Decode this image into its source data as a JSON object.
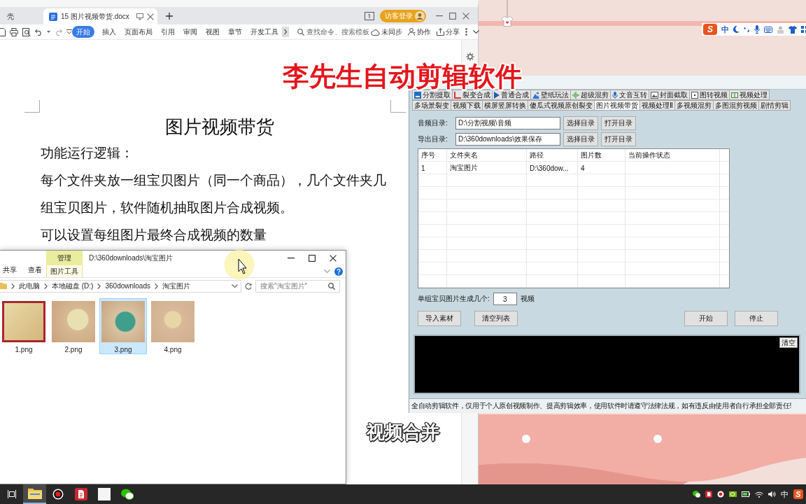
{
  "wps_window": {
    "tabs": [
      {
        "kind": "home",
        "label": "壳",
        "selected": false
      },
      {
        "kind": "document",
        "label": "15 图片视频带货.docx",
        "selected": true
      }
    ],
    "login_button": "访客登录",
    "ribbon_tabs": [
      {
        "label": "开始",
        "selected": true
      },
      {
        "label": "插入",
        "selected": false
      },
      {
        "label": "页面布局",
        "selected": false
      },
      {
        "label": "引用",
        "selected": false
      },
      {
        "label": "审阅",
        "selected": false
      },
      {
        "label": "视图",
        "selected": false
      },
      {
        "label": "章节",
        "selected": false
      },
      {
        "label": "开发工具",
        "selected": false
      }
    ],
    "search": {
      "placeholder": "查找命令、搜索模板"
    },
    "actions": [
      {
        "kind": "sync",
        "label": "未同步"
      },
      {
        "kind": "collaborate",
        "label": "协作"
      },
      {
        "kind": "share",
        "label": "分享"
      }
    ],
    "document": {
      "title": "图片视频带货",
      "paragraphs": [
        "功能运行逻辑：",
        "每个文件夹放一组宝贝图片（同一个商品），几个文件夹几",
        "组宝贝图片，软件随机抽取图片合成视频。",
        "可以设置每组图片最终合成视频的数量"
      ]
    }
  },
  "captions": [
    {
      "kind": "title",
      "text": "李先生自动剪辑软件"
    },
    {
      "kind": "subtitle",
      "text": "视频合并"
    }
  ],
  "ime_toolbar": {
    "logo": "S",
    "mode": "中"
  },
  "editor_window": {
    "tab_rows": [
      [
        {
          "kind": "split",
          "label": "分割提取",
          "selected": false
        },
        {
          "kind": "fission",
          "label": "裂变合成",
          "selected": false
        },
        {
          "kind": "play",
          "label": "普通合成",
          "selected": false
        },
        {
          "kind": "wallpaper",
          "label": "壁纸玩法",
          "selected": false
        },
        {
          "kind": "wave",
          "label": "超级混剪",
          "selected": false
        },
        {
          "kind": "mic",
          "label": "文音互转",
          "selected": false
        },
        {
          "kind": "image",
          "label": "封面截取",
          "selected": false
        },
        {
          "kind": "frame",
          "label": "图转视频",
          "selected": false
        },
        {
          "kind": "columns",
          "label": "视频处理",
          "selected": false
        }
      ],
      [
        {
          "label": "多场景裂变",
          "selected": false
        },
        {
          "label": "视频下载",
          "selected": false
        },
        {
          "label": "横屏竖屏转换",
          "selected": false
        },
        {
          "label": "傻瓜式视频原创裂变",
          "selected": false
        },
        {
          "label": "图片视频带货",
          "selected": true
        },
        {
          "label": "视频处理Ⅱ",
          "selected": false
        },
        {
          "label": "多视频混剪",
          "selected": false
        },
        {
          "label": "多图混剪视频",
          "selected": false
        },
        {
          "label": "剧情剪辑",
          "selected": false
        }
      ]
    ],
    "fields": [
      {
        "label": "音频目录:",
        "value": "D:\\分割视频\\音频",
        "buttons": [
          "选择目录",
          "打开目录"
        ]
      },
      {
        "label": "导出目录:",
        "value": "D:\\360downloads\\效果保存",
        "buttons": [
          "选择目录",
          "打开目录"
        ]
      }
    ],
    "table": {
      "columns": [
        "序号",
        "文件夹名",
        "路径",
        "图片数",
        "当前操作状态"
      ],
      "rows": [
        [
          "1",
          "淘宝图片",
          "D:\\360dow...",
          "4"
        ]
      ]
    },
    "per_group": {
      "label": "单组宝贝图片生成几个:",
      "value": "3",
      "unit": "视频"
    },
    "actions_left": [
      "导入素材",
      "清空列表"
    ],
    "actions_right": [
      "开始",
      "停止"
    ],
    "log": {
      "clear_button": "清空"
    },
    "status_bar": "全自动剪辑软件，仅用于个人原创视频制作、提高剪辑效率，使用软件时请遵守法律法规，如有违反由使用者自行承担全部责任!"
  },
  "explorer_window": {
    "title": "D:\\360downloads\\淘宝图片",
    "ribbon_tabs": [
      "共享",
      "查看"
    ],
    "context_tab": {
      "label": "管理",
      "sublabel": "图片工具"
    },
    "breadcrumb": [
      "此电脑",
      "本地磁盘 (D:)",
      "360downloads",
      "淘宝图片"
    ],
    "search": {
      "placeholder": "搜索\"淘宝图片\""
    },
    "files": [
      {
        "name": "1.png",
        "selected": false
      },
      {
        "name": "2.png",
        "selected": false
      },
      {
        "name": "3.png",
        "selected": true
      },
      {
        "name": "4.png",
        "selected": false
      }
    ]
  },
  "taskbar": {
    "apps": [
      {
        "kind": "task-view",
        "selected": false
      },
      {
        "kind": "explorer",
        "selected": true
      },
      {
        "kind": "recorder",
        "selected": false
      },
      {
        "kind": "wps",
        "selected": false
      },
      {
        "kind": "blank",
        "selected": false
      },
      {
        "kind": "chat",
        "selected": false
      }
    ],
    "tray": {
      "ime_mode": "中",
      "ime_logo": "S"
    }
  }
}
